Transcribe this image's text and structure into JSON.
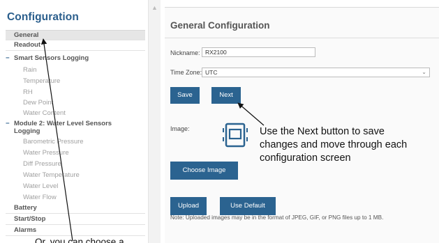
{
  "sidebar": {
    "title": "Configuration",
    "top_items": [
      {
        "label": "General",
        "selected": true
      },
      {
        "label": "Readout",
        "selected": false
      }
    ],
    "section1": {
      "label": "Smart Sensors Logging",
      "items": [
        "Rain",
        "Temperature",
        "RH",
        "Dew Point",
        "Water Content"
      ]
    },
    "section2": {
      "label_line1": "Module 2: Water Level Sensors",
      "label_line2": "Logging",
      "items": [
        "Barometric Pressure",
        "Water Pressure",
        "Diff Pressure",
        "Water Temperature",
        "Water Level",
        "Water Flow"
      ]
    },
    "bottom_items": [
      "Battery",
      "Start/Stop",
      "Alarms"
    ]
  },
  "main": {
    "title": "General Configuration",
    "nickname_label": "Nickname:",
    "nickname_value": "RX2100",
    "timezone_label": "Time Zone:",
    "timezone_value": "UTC",
    "save_label": "Save",
    "next_label": "Next",
    "image_label": "Image:",
    "choose_image_label": "Choose Image",
    "upload_label": "Upload",
    "use_default_label": "Use Default",
    "note": "Note: Uploaded images may be in the format of JPEG, GIF, or PNG files up to 1 MB."
  },
  "annotations": {
    "next_line1": "Use the Next button to save",
    "next_line2": "changes and move through each",
    "next_line3": "configuration screen",
    "choose_text": "Or, you can choose a"
  },
  "icons": {
    "scroll_up": "triangle-up-icon",
    "section_toggle": "minus-icon",
    "dropdown": "chevron-down-icon",
    "image_preview": "device-icon"
  },
  "colors": {
    "accent": "#2b6390",
    "title": "#2a5e8c"
  }
}
